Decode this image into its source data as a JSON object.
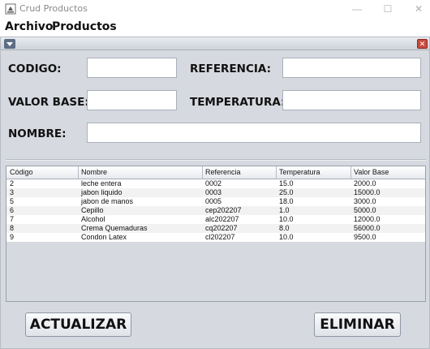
{
  "window": {
    "title": "Crud Productos"
  },
  "menubar": {
    "items": [
      "Archivo",
      "Productos"
    ]
  },
  "form": {
    "codigo_label": "CODIGO:",
    "referencia_label": "REFERENCIA:",
    "valor_base_label": "VALOR BASE:",
    "temperatura_label": "TEMPERATURA:",
    "nombre_label": "NOMBRE:",
    "codigo_value": "",
    "referencia_value": "",
    "valor_base_value": "",
    "temperatura_value": "",
    "nombre_value": ""
  },
  "table": {
    "columns": [
      "Código",
      "Nombre",
      "Referencia",
      "Temperatura",
      "Valor Base"
    ],
    "rows": [
      [
        "2",
        "leche entera",
        "0002",
        "15.0",
        "2000.0"
      ],
      [
        "3",
        "jabon liquido",
        "0003",
        "25.0",
        "15000.0"
      ],
      [
        "5",
        "jabon de manos",
        "0005",
        "18.0",
        "3000.0"
      ],
      [
        "6",
        "Cepillo",
        "cep202207",
        "1.0",
        "5000.0"
      ],
      [
        "7",
        "Alcohol",
        "alc202207",
        "10.0",
        "12000.0"
      ],
      [
        "8",
        "Crema Quemaduras",
        "cq202207",
        "8.0",
        "56000.0"
      ],
      [
        "9",
        "Condon Latex",
        "cl202207",
        "10.0",
        "9500.0"
      ]
    ]
  },
  "buttons": {
    "actualizar": "ACTUALIZAR",
    "eliminar": "ELIMINAR"
  },
  "titlebar_controls": {
    "minimize": "—",
    "maximize": "☐",
    "close": "✕"
  },
  "icons": {
    "app": "java-cup-icon",
    "frame_menu": "chevron-down-icon",
    "frame_close": "close-icon"
  },
  "colors": {
    "frame_bg": "#d6d9df",
    "close_red": "#c94a3e"
  }
}
